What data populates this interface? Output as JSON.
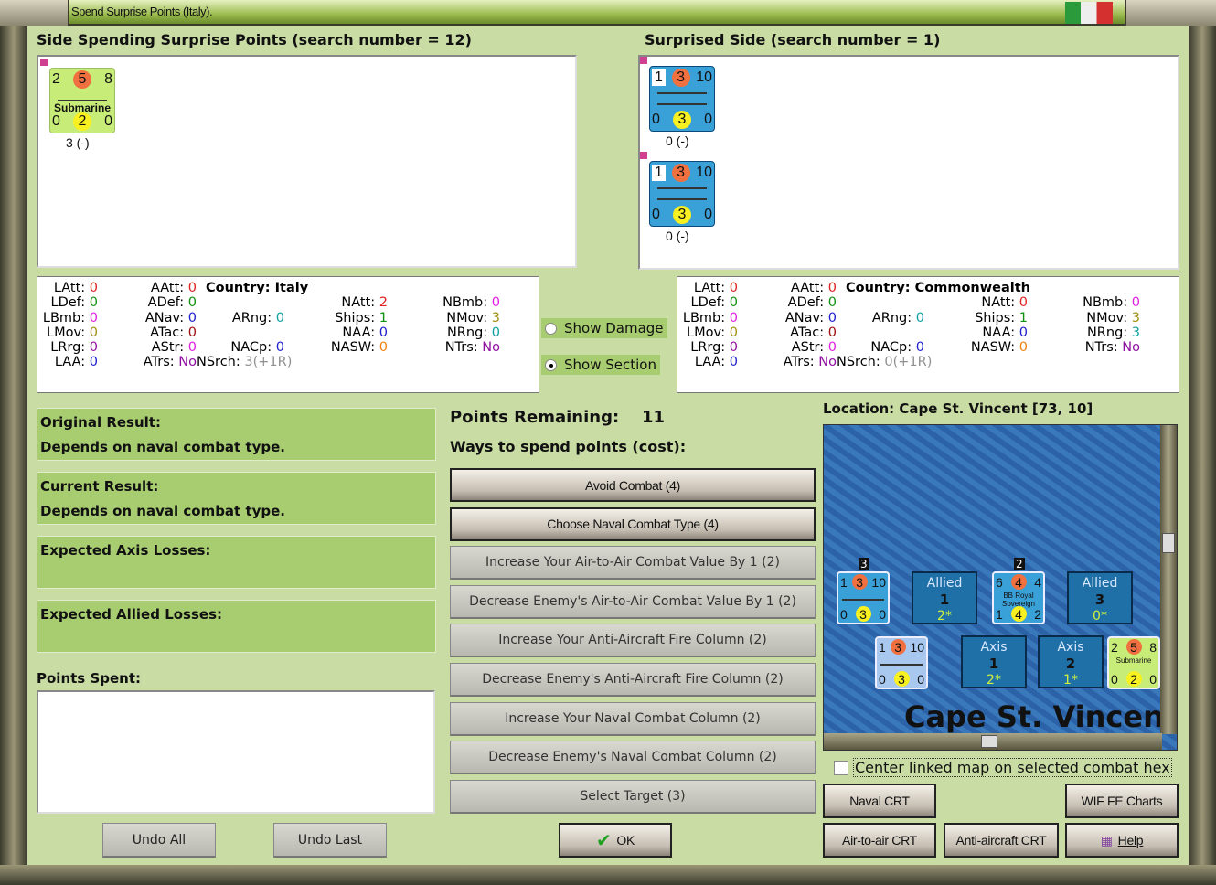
{
  "window": {
    "title": "Spend Surprise Points (Italy)."
  },
  "left_panel": {
    "title": "Side Spending Surprise Points (search number = 12)",
    "units": [
      {
        "top": [
          "2",
          "5",
          "8"
        ],
        "name": "Submarine",
        "bottom": [
          "0",
          "2",
          "0"
        ],
        "caption": "3 (-)",
        "color": "#c8ec78"
      }
    ]
  },
  "right_panel": {
    "title": "Surprised Side (search number = 1)",
    "units": [
      {
        "top": [
          "1",
          "3",
          "10"
        ],
        "name": "",
        "bottom": [
          "0",
          "3",
          "0"
        ],
        "caption": "0 (-)",
        "color": "#3aa0d8"
      },
      {
        "top": [
          "1",
          "3",
          "10"
        ],
        "name": "",
        "bottom": [
          "0",
          "3",
          "0"
        ],
        "caption": "0 (-)",
        "color": "#3aa0d8"
      }
    ]
  },
  "colors": {
    "red": "#e02020",
    "green": "#109010",
    "magenta": "#e020e0",
    "blue": "#2020d0",
    "teal": "#10a0a0",
    "olive": "#a09010",
    "darkred": "#a01010",
    "purple": "#9010a0",
    "orange": "#f08010",
    "gray": "#909090"
  },
  "stats_left": {
    "country": "Country: Italy",
    "rows": [
      [
        [
          "LAtt:",
          "0",
          "red"
        ],
        [
          "AAtt:",
          "0",
          "red"
        ],
        null,
        null,
        null
      ],
      [
        [
          "LDef:",
          "0",
          "green"
        ],
        [
          "ADef:",
          "0",
          "green"
        ],
        null,
        [
          "NAtt:",
          "2",
          "red"
        ],
        [
          "NBmb:",
          "0",
          "magenta"
        ]
      ],
      [
        [
          "LBmb:",
          "0",
          "magenta"
        ],
        [
          "ANav:",
          "0",
          "blue"
        ],
        [
          "ARng:",
          "0",
          "teal"
        ],
        [
          "Ships:",
          "1",
          "green"
        ],
        [
          "NMov:",
          "3",
          "olive"
        ]
      ],
      [
        [
          "LMov:",
          "0",
          "olive"
        ],
        [
          "ATac:",
          "0",
          "darkred"
        ],
        null,
        [
          "NAA:",
          "0",
          "blue"
        ],
        [
          "NRng:",
          "0",
          "teal"
        ]
      ],
      [
        [
          "LRrg:",
          "0",
          "purple"
        ],
        [
          "AStr:",
          "0",
          "magenta"
        ],
        [
          "NACp:",
          "0",
          "blue"
        ],
        [
          "NASW:",
          "0",
          "orange"
        ],
        [
          "NTrs:",
          "No",
          "purple"
        ]
      ],
      [
        [
          "LAA:",
          "0",
          "blue"
        ],
        [
          "ATrs:",
          "No",
          "purple"
        ],
        [
          "NSrch:",
          "3(+1R)",
          "gray"
        ],
        null,
        null
      ]
    ]
  },
  "stats_right": {
    "country": "Country: Commonwealth",
    "rows": [
      [
        [
          "LAtt:",
          "0",
          "red"
        ],
        [
          "AAtt:",
          "0",
          "red"
        ],
        null,
        null,
        null
      ],
      [
        [
          "LDef:",
          "0",
          "green"
        ],
        [
          "ADef:",
          "0",
          "green"
        ],
        null,
        [
          "NAtt:",
          "0",
          "red"
        ],
        [
          "NBmb:",
          "0",
          "magenta"
        ]
      ],
      [
        [
          "LBmb:",
          "0",
          "magenta"
        ],
        [
          "ANav:",
          "0",
          "blue"
        ],
        [
          "ARng:",
          "0",
          "teal"
        ],
        [
          "Ships:",
          "1",
          "green"
        ],
        [
          "NMov:",
          "3",
          "olive"
        ]
      ],
      [
        [
          "LMov:",
          "0",
          "olive"
        ],
        [
          "ATac:",
          "0",
          "darkred"
        ],
        null,
        [
          "NAA:",
          "0",
          "blue"
        ],
        [
          "NRng:",
          "3",
          "teal"
        ]
      ],
      [
        [
          "LRrg:",
          "0",
          "purple"
        ],
        [
          "AStr:",
          "0",
          "magenta"
        ],
        [
          "NACp:",
          "0",
          "blue"
        ],
        [
          "NASW:",
          "0",
          "orange"
        ],
        [
          "NTrs:",
          "No",
          "purple"
        ]
      ],
      [
        [
          "LAA:",
          "0",
          "blue"
        ],
        [
          "ATrs:",
          "No",
          "purple"
        ],
        [
          "NSrch:",
          "0(+1R)",
          "gray"
        ],
        null,
        null
      ]
    ]
  },
  "options": {
    "show_damage": "Show Damage",
    "show_section": "Show Section",
    "selected": "show_section"
  },
  "results": {
    "original_label": "Original Result:",
    "original_value": "Depends on naval combat type.",
    "current_label": "Current Result:",
    "current_value": "Depends on naval combat type.",
    "axis_losses_label": "Expected Axis Losses:",
    "allied_losses_label": "Expected Allied Losses:",
    "points_spent_label": "Points Spent:"
  },
  "spend": {
    "remaining_label": "Points Remaining:",
    "remaining": "11",
    "ways_label": "Ways to spend points (cost):",
    "buttons": [
      {
        "label": "Avoid Combat (4)",
        "enabled": true
      },
      {
        "label": "Choose Naval Combat Type (4)",
        "enabled": true
      },
      {
        "label": "Increase Your Air-to-Air Combat Value By 1 (2)",
        "enabled": false
      },
      {
        "label": "Decrease Enemy's Air-to-Air Combat Value By 1 (2)",
        "enabled": false
      },
      {
        "label": "Increase Your Anti-Aircraft Fire Column (2)",
        "enabled": false
      },
      {
        "label": "Decrease Enemy's Anti-Aircraft Fire Column (2)",
        "enabled": false
      },
      {
        "label": "Increase Your Naval Combat Column (2)",
        "enabled": false
      },
      {
        "label": "Decrease Enemy's Naval Combat Column (2)",
        "enabled": false
      },
      {
        "label": "Select Target (3)",
        "enabled": false
      }
    ]
  },
  "map": {
    "location": "Location: Cape St. Vincent [73, 10]",
    "label": "Cape St. Vincent",
    "boxes": [
      {
        "side": "Allied",
        "num": "1",
        "val": "2*"
      },
      {
        "side": "Allied",
        "num": "3",
        "val": "0*"
      },
      {
        "side": "Axis",
        "num": "1",
        "val": "2*"
      },
      {
        "side": "Axis",
        "num": "2",
        "val": "1*"
      }
    ],
    "stack_counts": [
      "3",
      "2"
    ],
    "ship_name": "BB Royal Sovereign",
    "bb_top": [
      "6",
      "4",
      "4"
    ],
    "bb_bottom": [
      "1",
      "4",
      "2"
    ]
  },
  "center_linked": {
    "label": "Center linked map on selected combat hex",
    "checked": false
  },
  "bottom": {
    "undo_all": "Undo All",
    "undo_last": "Undo Last",
    "ok": "OK",
    "naval_crt": "Naval CRT",
    "wif_charts": "WIF FE Charts",
    "air_crt": "Air-to-air CRT",
    "aa_crt": "Anti-aircraft CRT",
    "help": "Help"
  }
}
